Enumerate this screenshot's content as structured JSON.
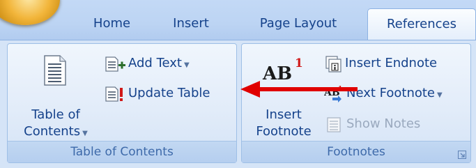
{
  "tabs": {
    "home": "Home",
    "insert": "Insert",
    "page_layout": "Page Layout",
    "references": "References"
  },
  "groups": {
    "toc": {
      "label": "Table of Contents",
      "toc_button": {
        "line1": "Table of",
        "line2": "Contents"
      },
      "add_text": "Add Text",
      "update_table": "Update Table"
    },
    "footnotes": {
      "label": "Footnotes",
      "insert_footnote": {
        "line1": "Insert",
        "line2": "Footnote",
        "icon_text": "AB",
        "icon_sup": "1"
      },
      "insert_endnote": "Insert Endnote",
      "next_footnote": "Next Footnote",
      "show_notes": "Show Notes"
    }
  },
  "colors": {
    "tab_text": "#15428b",
    "group_label": "#3e6aaa",
    "annotation_arrow": "#e00000",
    "disabled_text": "#9aa9be"
  },
  "icons": {
    "office_button": "office-logo",
    "toc": "document-lines-icon",
    "add_text": "add-text-icon",
    "update_table": "update-table-icon",
    "insert_footnote": "footnote-ab-icon",
    "insert_endnote": "endnote-icon",
    "next_footnote": "next-footnote-icon",
    "show_notes": "show-notes-icon",
    "dialog_launcher": "dialog-launcher-icon"
  }
}
